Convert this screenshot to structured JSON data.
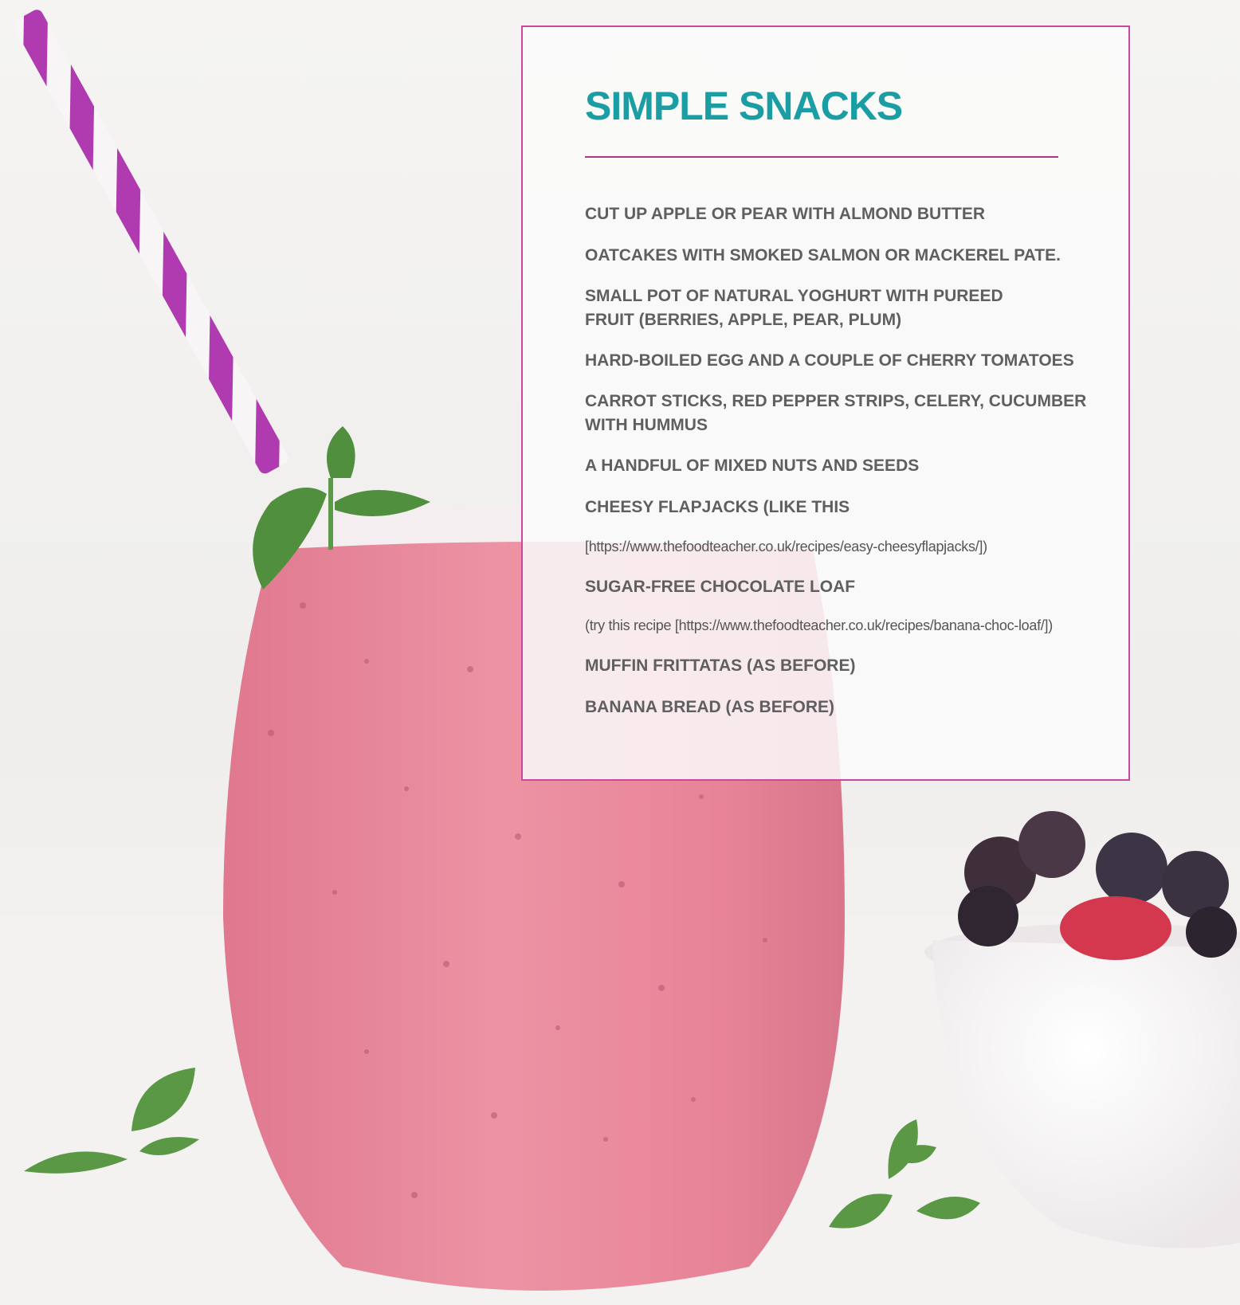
{
  "card": {
    "title": "SIMPLE SNACKS",
    "accent_color": "#1a9ea4",
    "border_color": "#c9479f",
    "items": [
      "CUT UP APPLE OR PEAR WITH ALMOND BUTTER",
      "OATCAKES WITH SMOKED SALMON OR MACKEREL PATE.",
      "SMALL POT OF NATURAL YOGHURT WITH PUREED",
      "FRUIT (BERRIES, APPLE, PEAR, PLUM)",
      "HARD-BOILED EGG AND A COUPLE OF CHERRY TOMATOES",
      "CARROT STICKS, RED PEPPER STRIPS, CELERY, CUCUMBER",
      "WITH HUMMUS",
      "A HANDFUL OF MIXED NUTS AND SEEDS",
      "CHEESY FLAPJACKS (LIKE THIS",
      "SUGAR-FREE CHOCOLATE LOAF",
      "MUFFIN FRITTATAS (AS BEFORE)",
      "BANANA BREAD (AS BEFORE)"
    ],
    "notes": [
      "[https://www.thefoodteacher.co.uk/recipes/easy-cheesyflapjacks/])",
      "(try this recipe [https://www.thefoodteacher.co.uk/recipes/banana-choc-loaf/])"
    ]
  },
  "photo": {
    "subject": "smoothie-glass-with-straw-and-berries",
    "smoothie_color": "#ea8a9c",
    "straw_color": "#b03ab0"
  }
}
